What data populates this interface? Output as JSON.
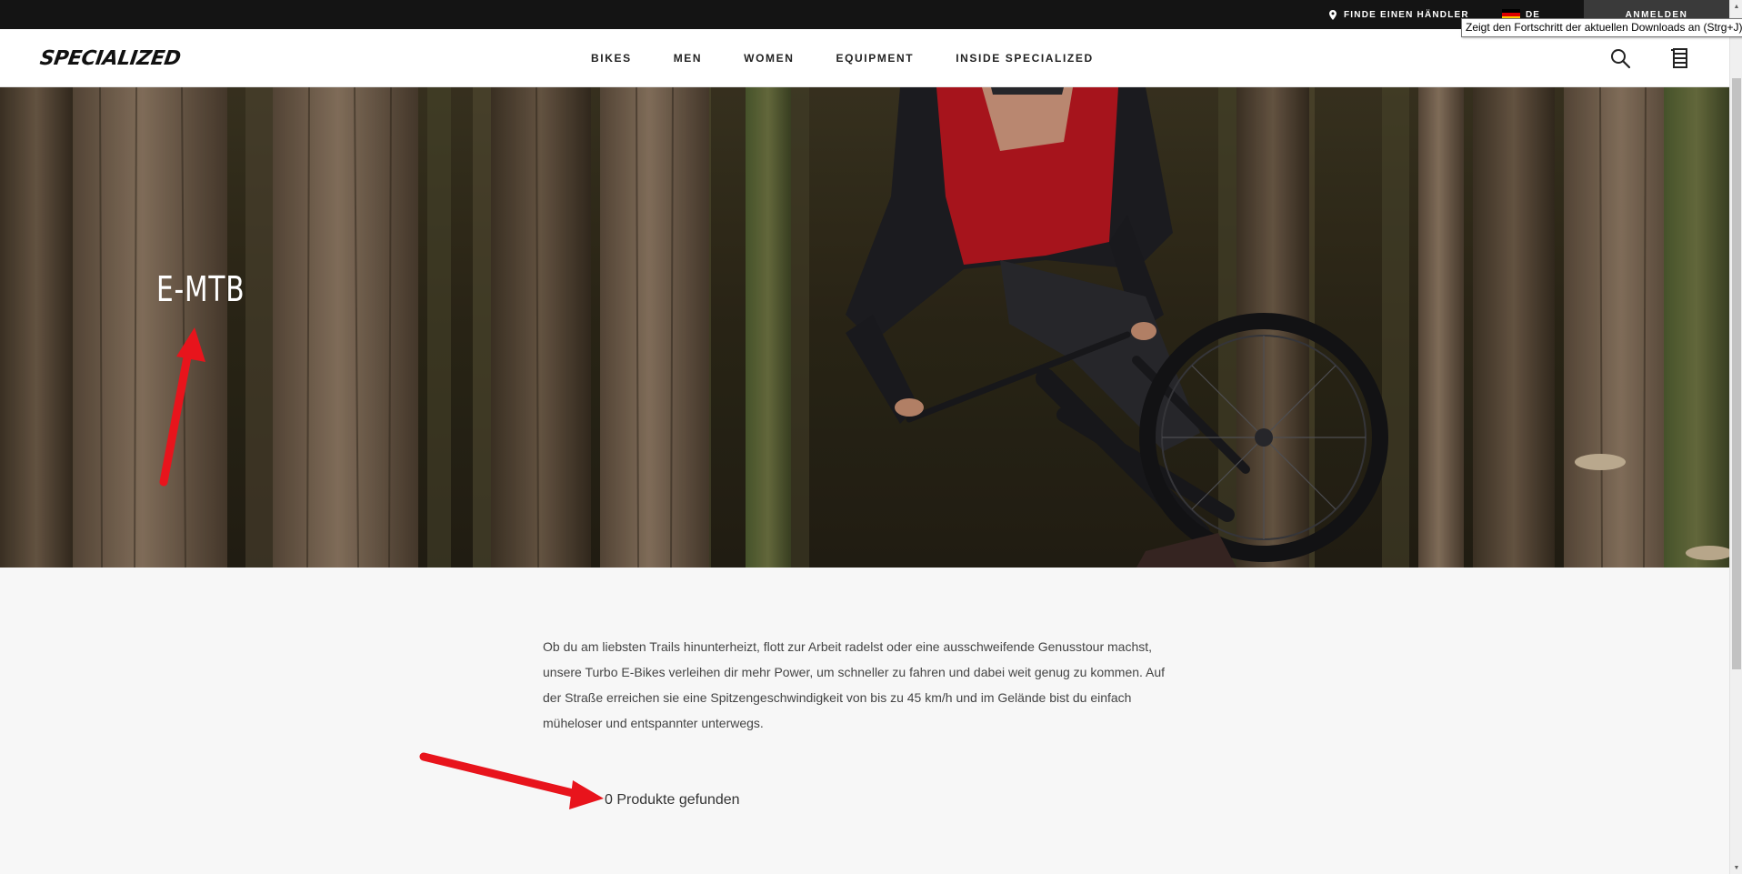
{
  "topbar": {
    "dealer_label": "FINDE EINEN HÄNDLER",
    "language_label": "DE",
    "login_label": "ANMELDEN",
    "tooltip": "Zeigt den Fortschritt der aktuellen Downloads an (Strg+J)"
  },
  "header": {
    "logo": "SPECIALIZED",
    "nav": [
      "BIKES",
      "MEN",
      "WOMEN",
      "EQUIPMENT",
      "INSIDE SPECIALIZED"
    ]
  },
  "icons": {
    "location": "location-pin-icon",
    "flag": "german-flag-icon",
    "search": "search-icon",
    "cart": "cart-icon"
  },
  "hero": {
    "title": "E-MTB"
  },
  "content": {
    "description": "Ob du am liebsten Trails hinunterheizt, flott zur Arbeit radelst oder eine ausschweifende Genusstour machst, unsere Turbo E-Bikes verleihen dir mehr Power, um schneller zu fahren und dabei weit genug zu kommen. Auf der Straße erreichen sie eine Spitzengeschwindigkeit von bis zu 45 km/h und im Gelände bist du einfach müheloser und entspannter unterwegs.",
    "product_count": "0 Produkte gefunden"
  },
  "colors": {
    "topbar_bg": "#141414",
    "login_bg": "#3a3a3a",
    "page_bg": "#f7f7f7",
    "annotation_red": "#e8141c"
  }
}
